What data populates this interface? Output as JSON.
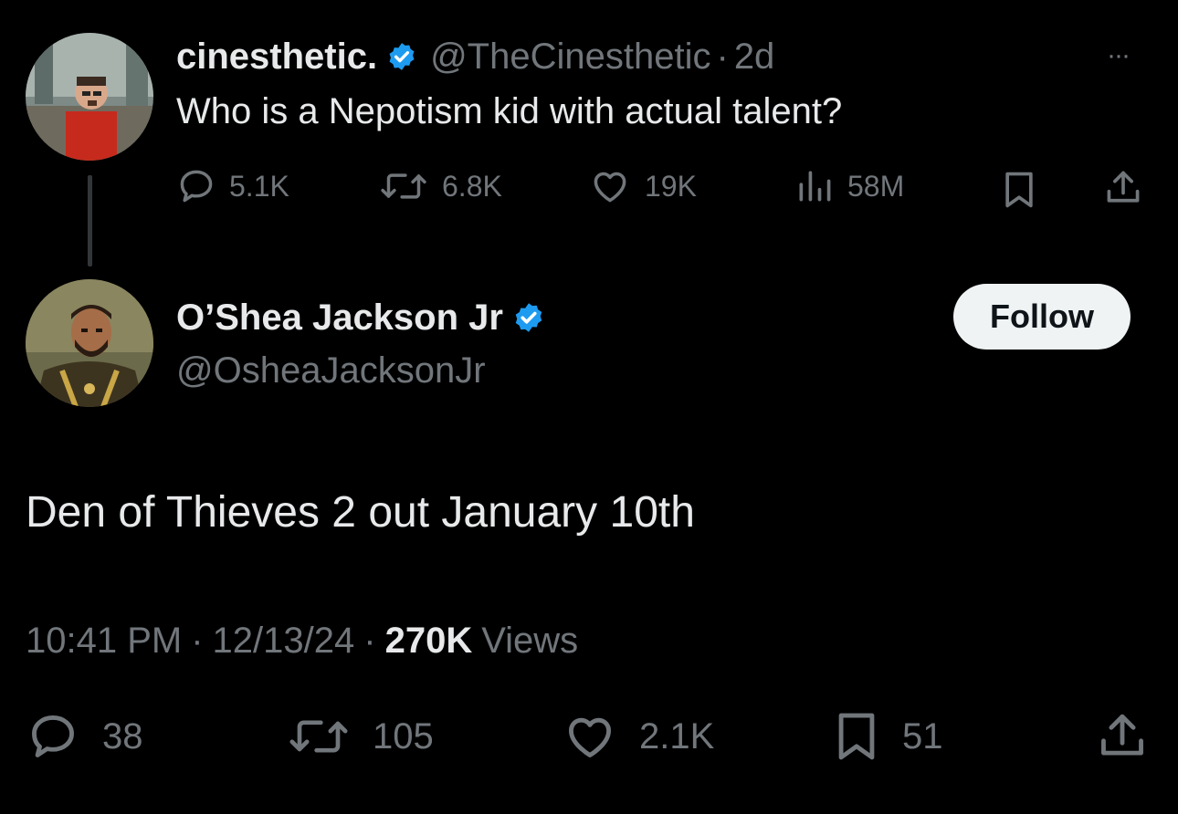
{
  "quoted_tweet": {
    "display_name": "cinesthetic.",
    "handle": "@TheCinesthetic",
    "separator": "·",
    "age": "2d",
    "text": "Who is a Nepotism kid with actual talent?",
    "more_label": "···",
    "stats": {
      "replies": "5.1K",
      "reposts": "6.8K",
      "likes": "19K",
      "views": "58M"
    }
  },
  "main_tweet": {
    "display_name": "O’Shea Jackson Jr",
    "handle": "@OsheaJacksonJr",
    "follow_label": "Follow",
    "text": "Den of Thieves 2 out January 10th",
    "time": "10:41 PM",
    "separator": "·",
    "date": "12/13/24",
    "views_count": "270K",
    "views_label": "Views",
    "stats": {
      "replies": "38",
      "reposts": "105",
      "likes": "2.1K",
      "bookmarks": "51"
    }
  },
  "colors": {
    "background": "#000000",
    "text": "#e7e9ea",
    "muted": "#71767b",
    "verified": "#1d9bf0",
    "button_bg": "#eff3f4"
  }
}
